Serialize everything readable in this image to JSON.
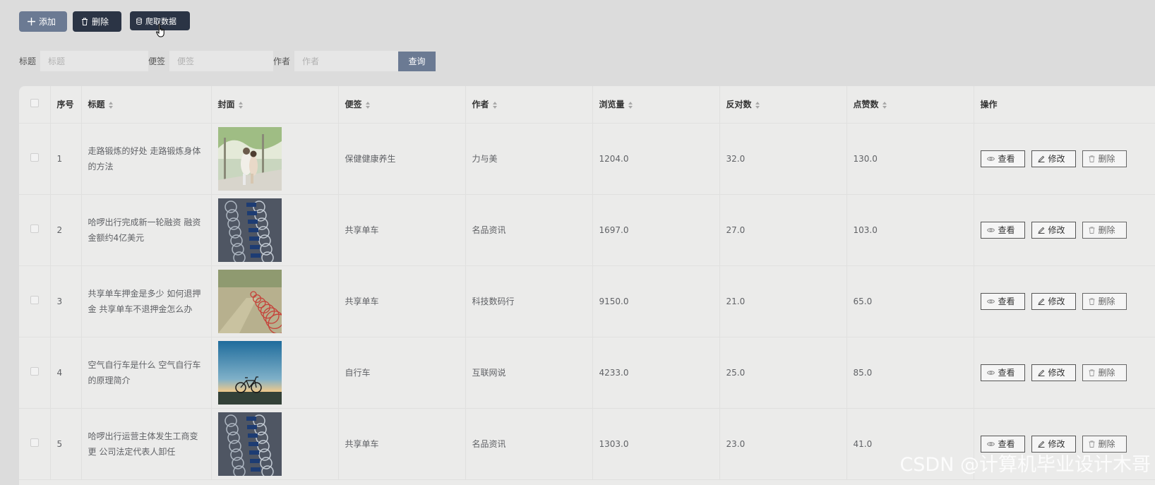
{
  "toolbar": {
    "add_label": "添加",
    "delete_label": "删除",
    "crawl_label": "爬取数据"
  },
  "search": {
    "title_label": "标题",
    "title_placeholder": "标题",
    "tag_label": "便签",
    "tag_placeholder": "便签",
    "author_label": "作者",
    "author_placeholder": "作者",
    "query_label": "查询"
  },
  "table": {
    "headers": {
      "index": "序号",
      "title": "标题",
      "cover": "封面",
      "tag": "便签",
      "author": "作者",
      "views": "浏览量",
      "dislikes": "反对数",
      "likes": "点赞数",
      "actions": "操作"
    },
    "rows": [
      {
        "index": "1",
        "title": "走路锻炼的好处 走路锻炼身体的方法",
        "tag": "保健健康养生",
        "author": "力与美",
        "views": "1204.0",
        "dislikes": "32.0",
        "likes": "130.0",
        "cover_icon": "couple-walking-photo"
      },
      {
        "index": "2",
        "title": "哈啰出行完成新一轮融资 融资金额约4亿美元",
        "tag": "共享单车",
        "author": "名品资讯",
        "views": "1697.0",
        "dislikes": "27.0",
        "likes": "103.0",
        "cover_icon": "bike-rack-photo"
      },
      {
        "index": "3",
        "title": "共享单车押金是多少 如何退押金 共享单车不退押金怎么办",
        "tag": "共享单车",
        "author": "科技数码行",
        "views": "9150.0",
        "dislikes": "21.0",
        "likes": "65.0",
        "cover_icon": "bike-row-photo"
      },
      {
        "index": "4",
        "title": "空气自行车是什么 空气自行车的原理简介",
        "tag": "自行车",
        "author": "互联网说",
        "views": "4233.0",
        "dislikes": "25.0",
        "likes": "85.0",
        "cover_icon": "bicycle-sunset-photo"
      },
      {
        "index": "5",
        "title": "哈啰出行运营主体发生工商变更 公司法定代表人卸任",
        "tag": "共享单车",
        "author": "名品资讯",
        "views": "1303.0",
        "dislikes": "23.0",
        "likes": "41.0",
        "cover_icon": "bike-rack-photo"
      }
    ],
    "actions": {
      "view": "查看",
      "edit": "修改",
      "delete": "删除"
    }
  },
  "watermark": "CSDN @计算机毕业设计木哥"
}
